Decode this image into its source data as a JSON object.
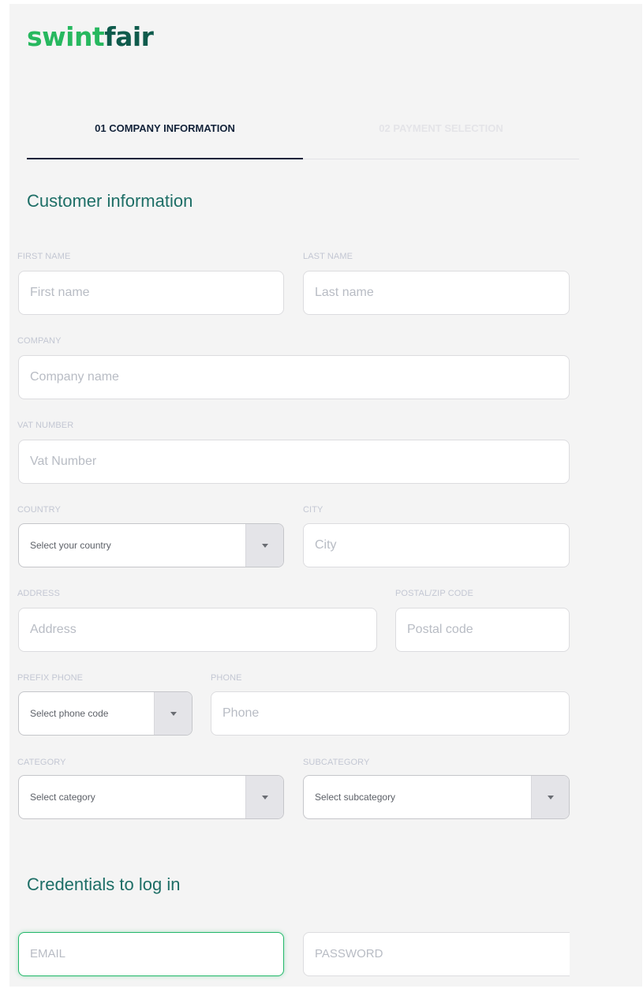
{
  "brand": {
    "logo_part1": "swint",
    "logo_part2": "fair"
  },
  "steps": [
    {
      "label": "01 COMPANY INFORMATION",
      "active": true
    },
    {
      "label": "02 PAYMENT SELECTION",
      "active": false
    }
  ],
  "customer_section": {
    "title": "Customer information"
  },
  "fields": {
    "first_name": {
      "label": "FIRST NAME",
      "placeholder": "First name"
    },
    "last_name": {
      "label": "LAST NAME",
      "placeholder": "Last name"
    },
    "company": {
      "label": "COMPANY",
      "placeholder": "Company name"
    },
    "vat": {
      "label": "VAT NUMBER",
      "placeholder": "Vat Number"
    },
    "country": {
      "label": "COUNTRY",
      "placeholder": "Select your country"
    },
    "city": {
      "label": "CITY",
      "placeholder": "City"
    },
    "address": {
      "label": "ADDRESS",
      "placeholder": "Address"
    },
    "postal": {
      "label": "POSTAL/ZIP CODE",
      "placeholder": "Postal code"
    },
    "prefix_phone": {
      "label": "PREFIX PHONE",
      "placeholder": "Select phone code"
    },
    "phone": {
      "label": "PHONE",
      "placeholder": "Phone"
    },
    "category": {
      "label": "CATEGORY",
      "placeholder": "Select category"
    },
    "subcategory": {
      "label": "SUBCATEGORY",
      "placeholder": "Select subcategory"
    }
  },
  "credentials_section": {
    "title": "Credentials to log in",
    "email_placeholder": "EMAIL",
    "password_placeholder": "PASSWORD"
  },
  "colors": {
    "brand_green": "#27b85f",
    "brand_dark": "#0f5b4c",
    "section_title": "#1d6e66",
    "active_step": "#13233a",
    "focus_border": "#23b86a"
  },
  "icons": {
    "select_arrow": "caret-down-icon"
  }
}
